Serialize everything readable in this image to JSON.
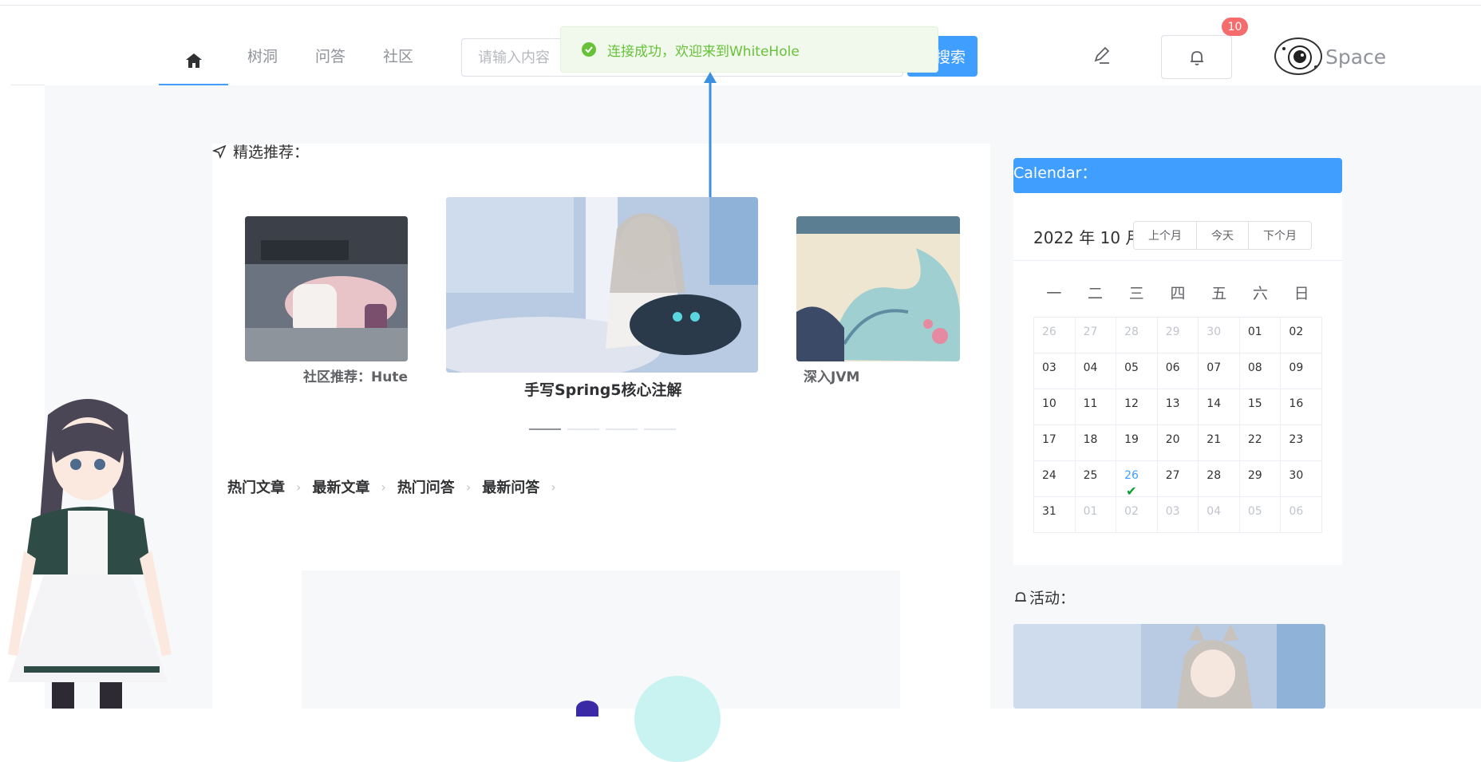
{
  "nav": {
    "home_label": "home",
    "items": [
      {
        "label": "树洞"
      },
      {
        "label": "问答"
      },
      {
        "label": "社区"
      }
    ]
  },
  "search": {
    "placeholder": "请输入内容",
    "button_label": "搜索"
  },
  "header": {
    "notification_count": "10",
    "space_label": "Space"
  },
  "toast": {
    "message": "连接成功，欢迎来到WhiteHole",
    "type": "success",
    "color": "#67c23a"
  },
  "featured": {
    "title": "精选推荐：",
    "slides": [
      {
        "caption": "社区推荐：Huterox"
      },
      {
        "caption": "手写Spring5核心注解"
      },
      {
        "caption": "深入JVM"
      }
    ],
    "active_index": 1
  },
  "article_tabs": [
    {
      "label": "热门文章"
    },
    {
      "label": "最新文章"
    },
    {
      "label": "热门问答"
    },
    {
      "label": "最新问答"
    }
  ],
  "calendar": {
    "title": "Calendar：",
    "year_month": "2022 年 10 月",
    "buttons": {
      "prev": "上个月",
      "today": "今天",
      "next": "下个月"
    },
    "weekdays": [
      "一",
      "二",
      "三",
      "四",
      "五",
      "六",
      "日"
    ],
    "weeks": [
      [
        {
          "d": "26",
          "m": true
        },
        {
          "d": "27",
          "m": true
        },
        {
          "d": "28",
          "m": true
        },
        {
          "d": "29",
          "m": true
        },
        {
          "d": "30",
          "m": true
        },
        {
          "d": "01"
        },
        {
          "d": "02"
        }
      ],
      [
        {
          "d": "03"
        },
        {
          "d": "04"
        },
        {
          "d": "05"
        },
        {
          "d": "06"
        },
        {
          "d": "07"
        },
        {
          "d": "08"
        },
        {
          "d": "09"
        }
      ],
      [
        {
          "d": "10"
        },
        {
          "d": "11"
        },
        {
          "d": "12"
        },
        {
          "d": "13"
        },
        {
          "d": "14"
        },
        {
          "d": "15"
        },
        {
          "d": "16"
        }
      ],
      [
        {
          "d": "17"
        },
        {
          "d": "18"
        },
        {
          "d": "19"
        },
        {
          "d": "20"
        },
        {
          "d": "21"
        },
        {
          "d": "22"
        },
        {
          "d": "23"
        }
      ],
      [
        {
          "d": "24"
        },
        {
          "d": "25"
        },
        {
          "d": "26",
          "today": true,
          "checked": true
        },
        {
          "d": "27"
        },
        {
          "d": "28"
        },
        {
          "d": "29"
        },
        {
          "d": "30"
        }
      ],
      [
        {
          "d": "31"
        },
        {
          "d": "01",
          "m": true
        },
        {
          "d": "02",
          "m": true
        },
        {
          "d": "03",
          "m": true
        },
        {
          "d": "04",
          "m": true
        },
        {
          "d": "05",
          "m": true
        },
        {
          "d": "06",
          "m": true
        }
      ]
    ]
  },
  "activity": {
    "title": "活动："
  },
  "colors": {
    "accent": "#409eff",
    "badge": "#f56c6c",
    "success": "#67c23a",
    "checkmark": "#0a9e2c"
  }
}
